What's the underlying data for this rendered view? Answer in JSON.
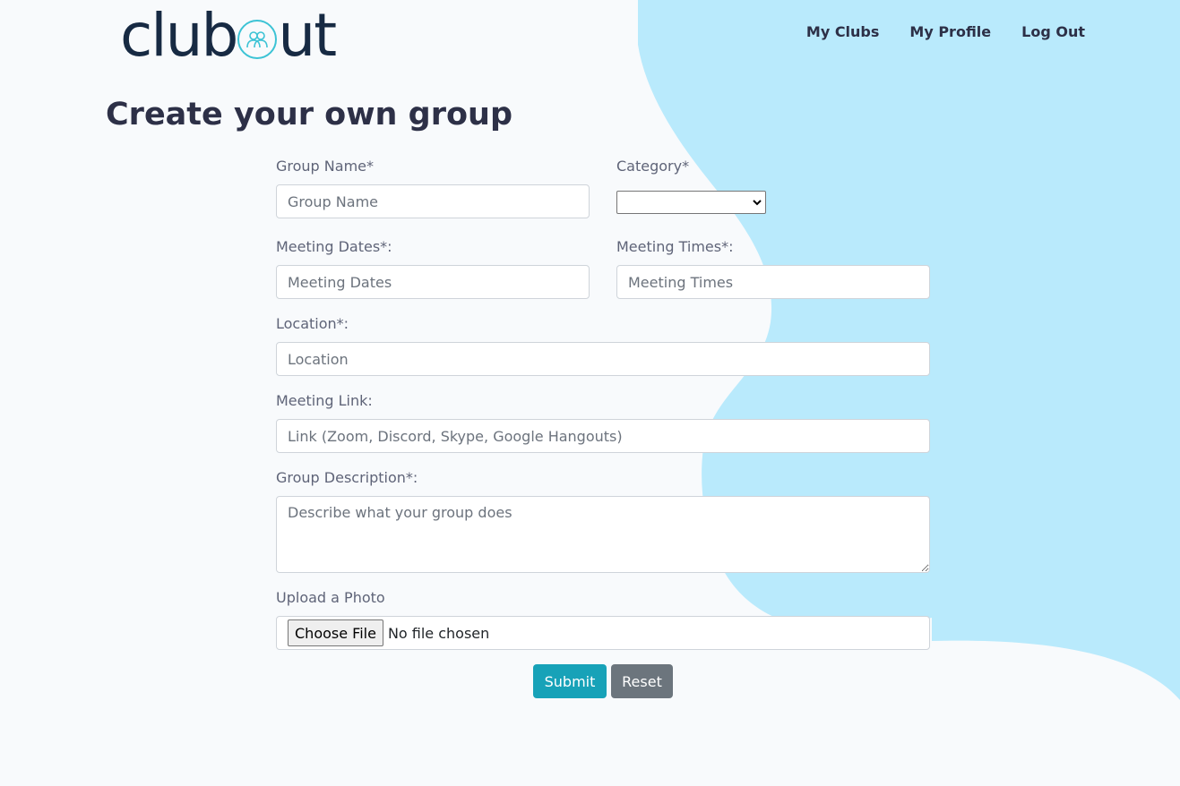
{
  "brand": {
    "logo_text_left": "club",
    "logo_text_right": "ut"
  },
  "nav": {
    "items": [
      "My Clubs",
      "My Profile",
      "Log Out"
    ]
  },
  "page": {
    "title": "Create your own group"
  },
  "form": {
    "group_name": {
      "label": "Group Name*",
      "placeholder": "Group Name",
      "value": ""
    },
    "category": {
      "label": "Category*",
      "selected": ""
    },
    "meeting_dates": {
      "label": "Meeting Dates*:",
      "placeholder": "Meeting Dates",
      "value": ""
    },
    "meeting_times": {
      "label": "Meeting Times*:",
      "placeholder": "Meeting Times",
      "value": ""
    },
    "location": {
      "label": "Location*:",
      "placeholder": "Location",
      "value": ""
    },
    "meeting_link": {
      "label": "Meeting Link:",
      "placeholder": "Link (Zoom, Discord, Skype, Google Hangouts)",
      "value": ""
    },
    "description": {
      "label": "Group Description*:",
      "placeholder": "Describe what your group does",
      "value": ""
    },
    "photo": {
      "label": "Upload a Photo",
      "button": "Choose File",
      "status": "No file chosen"
    },
    "submit_label": "Submit",
    "reset_label": "Reset"
  },
  "colors": {
    "background": "#f8fafc",
    "blob": "#b9eafc",
    "accent": "#17a2b8",
    "secondary": "#6c757d",
    "brand_dark": "#172a43",
    "logo_ring": "#3cc3d5"
  },
  "icons": {
    "logo_mark": "people-icon",
    "select_arrow": "chevron-down-icon"
  }
}
